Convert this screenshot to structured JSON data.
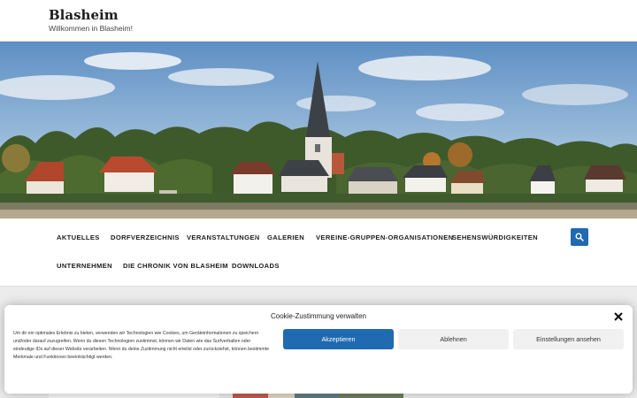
{
  "header": {
    "title": "Blasheim",
    "tagline": "Willkommen in Blasheim!"
  },
  "navigation": {
    "items": [
      {
        "label": "AKTUELLES"
      },
      {
        "label": "DORFVERZEICHNIS"
      },
      {
        "label": "VERANSTALTUNGEN",
        "has_submenu": true
      },
      {
        "label": "GALERIEN"
      },
      {
        "label": "VEREINE-GRUPPEN-ORGANISATIONEN"
      },
      {
        "label": "SEHENSWÜRDIGKEITEN"
      },
      {
        "label": "UNTERNEHMEN"
      },
      {
        "label": "DIE CHRONIK VON BLASHEIM"
      },
      {
        "label": "DOWNLOADS"
      }
    ],
    "search_icon": "search-icon"
  },
  "cookie": {
    "title": "Cookie-Zustimmung verwalten",
    "text": "Um dir ein optimales Erlebnis zu bieten, verwenden wir Technologien wie Cookies, um Geräteinformationen zu speichern und/oder darauf zuzugreifen. Wenn du diesen Technologien zustimmst, können wir Daten wie das Surfverhalten oder eindeutige IDs auf dieser Website verarbeiten. Wenn du deine Zustimmung nicht erteilst oder zurückziehst, können bestimmte Merkmale und Funktionen beeinträchtigt werden.",
    "accept_label": "Akzeptieren",
    "deny_label": "Ablehnen",
    "preferences_label": "Einstellungen ansehen",
    "close_icon": "close-icon"
  },
  "colors": {
    "accent": "#1f6ab0",
    "background": "#ececec"
  }
}
